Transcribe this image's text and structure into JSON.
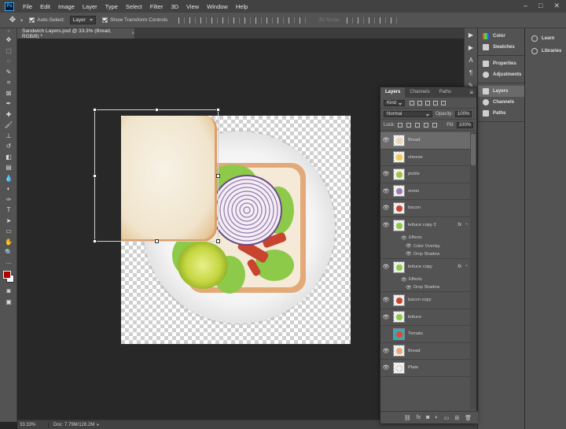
{
  "menubar": {
    "logo": "Ps",
    "items": [
      "File",
      "Edit",
      "Image",
      "Layer",
      "Type",
      "Select",
      "Filter",
      "3D",
      "View",
      "Window",
      "Help"
    ]
  },
  "options": {
    "auto_select_label": "Auto-Select:",
    "auto_select_value": "Layer",
    "transform_label": "Show Transform Controls",
    "mode_3d": "3D Mode:"
  },
  "document": {
    "tab_title": "Sandwich Layers.psd @ 33.3% (Bread, RGB/8) *",
    "close": "×"
  },
  "statusbar": {
    "zoom": "33.33%",
    "doc_info": "Doc: 7.79M/126.2M"
  },
  "panels_col1": {
    "group1": [
      "Color",
      "Swatches"
    ],
    "group2": [
      "Properties",
      "Adjustments"
    ],
    "group3": [
      "Layers",
      "Channels",
      "Paths"
    ]
  },
  "panels_col2": [
    "Learn",
    "Libraries"
  ],
  "layers_panel": {
    "tabs": [
      "Layers",
      "Channels",
      "Paths"
    ],
    "kind_label": "Kind",
    "blend_mode": "Normal",
    "opacity_label": "Opacity:",
    "opacity_value": "100%",
    "lock_label": "Lock:",
    "fill_label": "Fill:",
    "fill_value": "100%",
    "layers": [
      {
        "name": "Bread",
        "visible": true,
        "selected": true,
        "thumb": "#e8d6b4"
      },
      {
        "name": "cheese",
        "visible": false,
        "selected": false,
        "thumb": "#f2c94c"
      },
      {
        "name": "pickle",
        "visible": true,
        "selected": false,
        "thumb": "#a6c23a"
      },
      {
        "name": "onion",
        "visible": true,
        "selected": false,
        "thumb": "#9b7bb3"
      },
      {
        "name": "bacon",
        "visible": true,
        "selected": false,
        "thumb": "#c8442e"
      },
      {
        "name": "lettuce copy 2",
        "visible": true,
        "selected": false,
        "thumb": "#8dca4a",
        "fx": "fx",
        "effects": [
          "Color Overlay",
          "Drop Shadow"
        ]
      },
      {
        "name": "lettuce copy",
        "visible": true,
        "selected": false,
        "thumb": "#8dca4a",
        "fx": "fx",
        "effects": [
          "Drop Shadow"
        ]
      },
      {
        "name": "bacon copy",
        "visible": true,
        "selected": false,
        "thumb": "#c8442e"
      },
      {
        "name": "lettuce",
        "visible": true,
        "selected": false,
        "thumb": "#8dca4a"
      },
      {
        "name": "Tomato",
        "visible": false,
        "selected": false,
        "thumb": "#e04a2f"
      },
      {
        "name": "Bread",
        "visible": true,
        "selected": false,
        "thumb": "#e3a978"
      },
      {
        "name": "Plate",
        "visible": true,
        "selected": false,
        "thumb": "#f0f0f0"
      }
    ],
    "effects_label": "Effects"
  },
  "colors": {
    "foreground": "#b00000",
    "background": "#ffffff",
    "panel_bg": "#535353",
    "canvas_bg": "#282828"
  }
}
